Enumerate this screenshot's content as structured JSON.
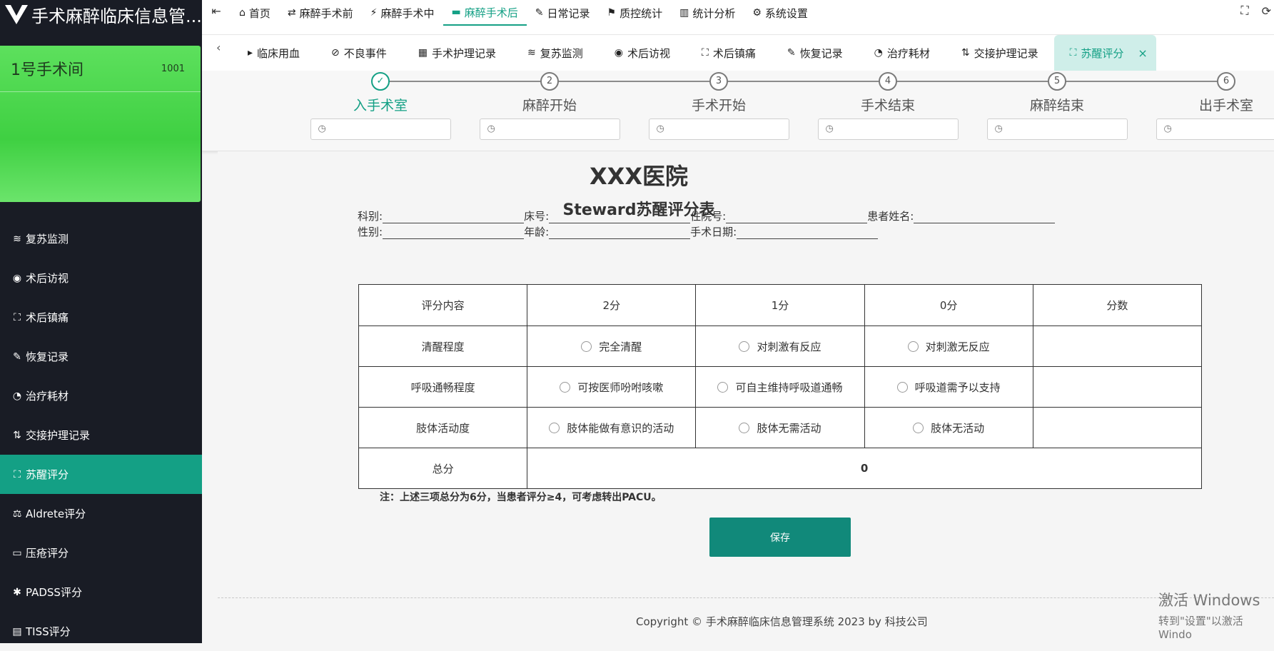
{
  "app": {
    "title": "手术麻醉临床信息管..."
  },
  "room": {
    "name": "1号手术间",
    "code": "1001"
  },
  "sidebar": {
    "items": [
      {
        "label": "复苏监测",
        "icon": "eye-closed-icon",
        "glyph": "≋"
      },
      {
        "label": "术后访视",
        "icon": "eye-icon",
        "glyph": "◉"
      },
      {
        "label": "术后镇痛",
        "icon": "scan-icon",
        "glyph": "⛶"
      },
      {
        "label": "恢复记录",
        "icon": "edit-icon",
        "glyph": "✎"
      },
      {
        "label": "治疗耗材",
        "icon": "check-circle-icon",
        "glyph": "◔"
      },
      {
        "label": "交接护理记录",
        "icon": "swap-icon",
        "glyph": "⇅"
      },
      {
        "label": "苏醒评分",
        "icon": "scan-face-icon",
        "glyph": "⛶"
      },
      {
        "label": "Aldrete评分",
        "icon": "gavel-icon",
        "glyph": "⚖"
      },
      {
        "label": "压疮评分",
        "icon": "minus-square-icon",
        "glyph": "▭"
      },
      {
        "label": "PADSS评分",
        "icon": "asterisk-icon",
        "glyph": "✱"
      },
      {
        "label": "TISS评分",
        "icon": "message-icon",
        "glyph": "▤"
      }
    ]
  },
  "nav": {
    "items": [
      {
        "label": "首页",
        "glyph": "⌂"
      },
      {
        "label": "麻醉手术前",
        "glyph": "⇄"
      },
      {
        "label": "麻醉手术中",
        "glyph": "⚡"
      },
      {
        "label": "麻醉手术后",
        "glyph": "▬"
      },
      {
        "label": "日常记录",
        "glyph": "✎"
      },
      {
        "label": "质控统计",
        "glyph": "⚑"
      },
      {
        "label": "统计分析",
        "glyph": "▥"
      },
      {
        "label": "系统设置",
        "glyph": "⚙"
      }
    ],
    "active": "麻醉手术后"
  },
  "tabs": {
    "items": [
      {
        "label": "临床用血",
        "glyph": "▸"
      },
      {
        "label": "不良事件",
        "glyph": "⊘"
      },
      {
        "label": "手术护理记录",
        "glyph": "▦"
      },
      {
        "label": "复苏监测",
        "glyph": "≋"
      },
      {
        "label": "术后访视",
        "glyph": "◉"
      },
      {
        "label": "术后镇痛",
        "glyph": "⛶"
      },
      {
        "label": "恢复记录",
        "glyph": "✎"
      },
      {
        "label": "治疗耗材",
        "glyph": "◔"
      },
      {
        "label": "交接护理记录",
        "glyph": "⇅"
      },
      {
        "label": "苏醒评分",
        "glyph": "⛶"
      }
    ],
    "active": "苏醒评分"
  },
  "steps": [
    {
      "num": "✓",
      "label": "入手术室",
      "done": true
    },
    {
      "num": "2",
      "label": "麻醉开始"
    },
    {
      "num": "3",
      "label": "手术开始"
    },
    {
      "num": "4",
      "label": "手术结束"
    },
    {
      "num": "5",
      "label": "麻醉结束"
    },
    {
      "num": "6",
      "label": "出手术室"
    }
  ],
  "form": {
    "hospital": "XXX医院",
    "title": "Steward苏醒评分表",
    "fields_row1": [
      "科别:",
      "床号:",
      "住院号:",
      "患者姓名:"
    ],
    "fields_row2": [
      "性别:",
      "年龄:",
      "手术日期:"
    ],
    "table": {
      "headers": [
        "评分内容",
        "2分",
        "1分",
        "0分",
        "分数"
      ],
      "rows": [
        {
          "label": "清醒程度",
          "options": [
            "完全清醒",
            "对刺激有反应",
            "对刺激无反应"
          ]
        },
        {
          "label": "呼吸通畅程度",
          "options": [
            "可按医师吩咐咳嗽",
            "可自主维持呼吸道通畅",
            "呼吸道需予以支持"
          ]
        },
        {
          "label": "肢体活动度",
          "options": [
            "肢体能做有意识的活动",
            "肢体无需活动",
            "肢体无活动"
          ]
        }
      ],
      "total_label": "总分",
      "total_value": "0"
    },
    "note": "注：上述三项总分为6分，当患者评分≥4，可考虑转出PACU。",
    "save_label": "保存"
  },
  "footer": {
    "text": "Copyright © 手术麻醉临床信息管理系统 2023 by 科技公司"
  },
  "watermark": {
    "line1": "激活 Windows",
    "line2": "转到\"设置\"以激活 Windo"
  },
  "colors": {
    "accent": "#14a085",
    "sidebar": "#191c25",
    "room_card": "#46d449"
  }
}
